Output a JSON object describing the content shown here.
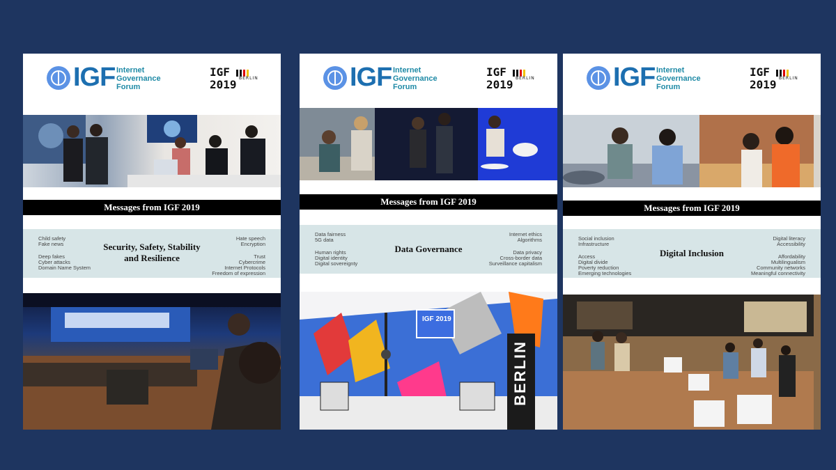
{
  "brand": {
    "igf": "IGF",
    "igf_full": "Internet Governance Forum",
    "badge_line1": "IGF",
    "badge_line2": "2019",
    "badge_city": "BERLIN"
  },
  "cards": [
    {
      "banner": "Messages from IGF 2019",
      "title": "Security, Safety, Stability and Resilience",
      "kw_left": [
        "Child safety",
        "Fake news",
        "",
        "Deep fakes",
        "Cyber attacks",
        "Domain Name System"
      ],
      "kw_right": [
        "Hate speech",
        "Encryption",
        "",
        "Trust",
        "Cybercrime",
        "Internet Protocols",
        "Freedom of expression"
      ]
    },
    {
      "banner": "Messages from IGF 2019",
      "title": "Data Governance",
      "kw_left": [
        "Data fairness",
        "5G data",
        "",
        "Human rights",
        "Digital identity",
        "Digital sovereignty"
      ],
      "kw_right": [
        "Internet ethics",
        "Algorithms",
        "",
        "Data privacy",
        "Cross-border data",
        "Surveillance capitalism"
      ],
      "mural_tv": "IGF 2019",
      "mural_city": "BERLIN"
    },
    {
      "banner": "Messages from IGF 2019",
      "title": "Digital Inclusion",
      "kw_left": [
        "Social inclusion",
        "Infrastructure",
        "",
        "Access",
        "Digital divide",
        "Poverty reduction",
        "Emerging technologies"
      ],
      "kw_right": [
        "Digital literacy",
        "Accessibility",
        "",
        "Affordability",
        "Multilingualism",
        "Community networks",
        "Meaningful connectivity"
      ]
    }
  ],
  "colors": {
    "background": "#1e3560",
    "banner": "#000000",
    "topic_band": "#d7e5e7",
    "igf_blue": "#1d6fb0"
  }
}
